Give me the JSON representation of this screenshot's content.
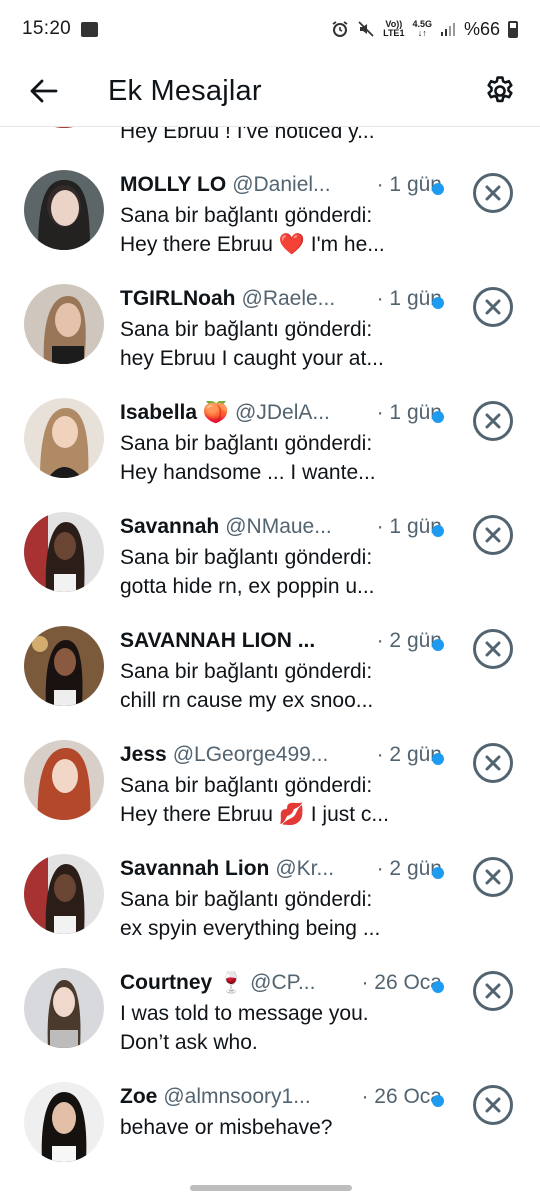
{
  "status_bar": {
    "time": "15:20",
    "network_top": "4.5G",
    "network_label_top": "Vo))",
    "network_label_bottom": "LTE1",
    "battery": "%66"
  },
  "header": {
    "title": "Ek Mesajlar",
    "back_icon": "arrow-left-icon",
    "settings_icon": "gear-icon"
  },
  "partial_row": {
    "message": "Hey Ebruu ! I've noticed y..."
  },
  "rows": [
    {
      "name": "MOLLY LO",
      "handle": "@Daniel...",
      "time": "· 1 gün",
      "line1": "Sana bir bağlantı gönderdi:",
      "line2": "Hey there Ebruu ❤️ I'm he...",
      "unread": true
    },
    {
      "name": "TGIRLNoah",
      "handle": "@Raele...",
      "time": "· 1 gün",
      "line1": "Sana bir bağlantı gönderdi:",
      "line2": "hey Ebruu I caught your at...",
      "unread": true
    },
    {
      "name": "Isabella 🍑",
      "handle": "@JDelA...",
      "time": "· 1 gün",
      "line1": "Sana bir bağlantı gönderdi:",
      "line2": "Hey handsome ... I wante...",
      "unread": true
    },
    {
      "name": "Savannah",
      "handle": "@NMaue...",
      "time": "· 1 gün",
      "line1": "Sana bir bağlantı gönderdi:",
      "line2": "gotta hide rn, ex poppin u...",
      "unread": true
    },
    {
      "name": "SAVANNAH LION ...",
      "handle": "",
      "time": "· 2 gün",
      "line1": "Sana bir bağlantı gönderdi:",
      "line2": "chill rn cause my ex snoo...",
      "unread": true
    },
    {
      "name": "Jess",
      "handle": "@LGeorge499...",
      "time": "· 2 gün",
      "line1": "Sana bir bağlantı gönderdi:",
      "line2": "Hey there Ebruu 💋 I just c...",
      "unread": true
    },
    {
      "name": "Savannah Lion",
      "handle": "@Kr...",
      "time": "· 2 gün",
      "line1": "Sana bir bağlantı gönderdi:",
      "line2": "ex spyin everything being ...",
      "unread": true
    },
    {
      "name": "Courtney 🍷",
      "handle": "@CP...",
      "time": "· 26 Oca",
      "line1": "I was told to message you.",
      "line2": "Don’t ask who.",
      "unread": true
    },
    {
      "name": "Zoe",
      "handle": "@almnsoory1...",
      "time": "· 26 Oca",
      "line1": "behave or misbehave?",
      "line2": "",
      "unread": true
    }
  ],
  "colors": {
    "accent_blue": "#1d9bf0",
    "secondary_text": "#536471",
    "primary_text": "#0f1419"
  }
}
